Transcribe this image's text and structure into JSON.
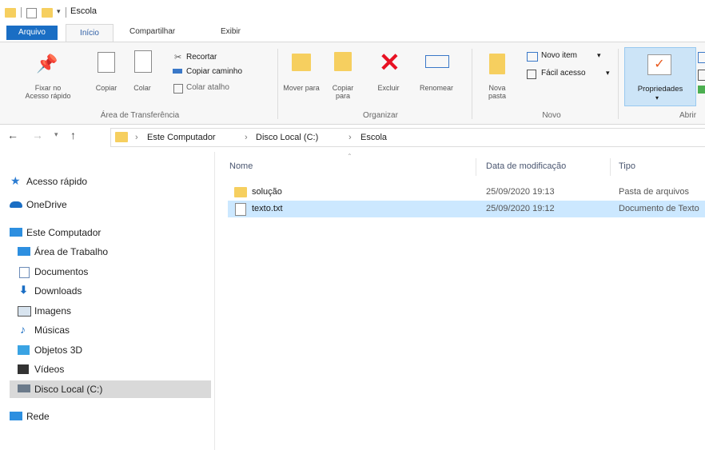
{
  "window": {
    "title": "Escola"
  },
  "ribbon_tabs": {
    "file": "Arquivo",
    "home": "Início",
    "share": "Compartilhar",
    "view": "Exibir"
  },
  "ribbon": {
    "pin": "Fixar no Acesso rápido",
    "copy": "Copiar",
    "paste": "Colar",
    "cut": "Recortar",
    "copy_path": "Copiar caminho",
    "paste_shortcut": "Colar atalho",
    "clipboard_group": "Área de Transferência",
    "move_to": "Mover para",
    "copy_to": "Copiar para",
    "delete": "Excluir",
    "rename": "Renomear",
    "organize_group": "Organizar",
    "new_folder": "Nova pasta",
    "new_item": "Novo item",
    "easy_access": "Fácil acesso",
    "new_group": "Novo",
    "properties": "Propriedades",
    "open_group": "Abrir"
  },
  "address": {
    "crumbs": [
      "Este Computador",
      "Disco Local (C:)",
      "Escola"
    ]
  },
  "nav": [
    {
      "label": "Acesso rápido",
      "icon": "star-icon"
    },
    {
      "label": "OneDrive",
      "icon": "cloud-icon"
    },
    {
      "label": "Este Computador",
      "icon": "computer-icon"
    },
    {
      "label": "Área de Trabalho",
      "icon": "desktop-icon"
    },
    {
      "label": "Documentos",
      "icon": "documents-icon"
    },
    {
      "label": "Downloads",
      "icon": "download-icon"
    },
    {
      "label": "Imagens",
      "icon": "images-icon"
    },
    {
      "label": "Músicas",
      "icon": "music-icon"
    },
    {
      "label": "Objetos 3D",
      "icon": "objects3d-icon"
    },
    {
      "label": "Vídeos",
      "icon": "videos-icon"
    },
    {
      "label": "Disco Local (C:)",
      "icon": "drive-icon"
    },
    {
      "label": "Rede",
      "icon": "network-icon"
    }
  ],
  "columns": {
    "name": "Nome",
    "date": "Data de modificação",
    "type": "Tipo"
  },
  "files": [
    {
      "name": "solução",
      "date": "25/09/2020 19:13",
      "type": "Pasta de arquivos"
    },
    {
      "name": "texto.txt",
      "date": "25/09/2020 19:12",
      "type": "Documento de Texto"
    }
  ],
  "colors": {
    "accent": "#1a6ec4",
    "selection": "#cce8ff",
    "folder": "#f6cf5f",
    "delete": "#e81123"
  }
}
